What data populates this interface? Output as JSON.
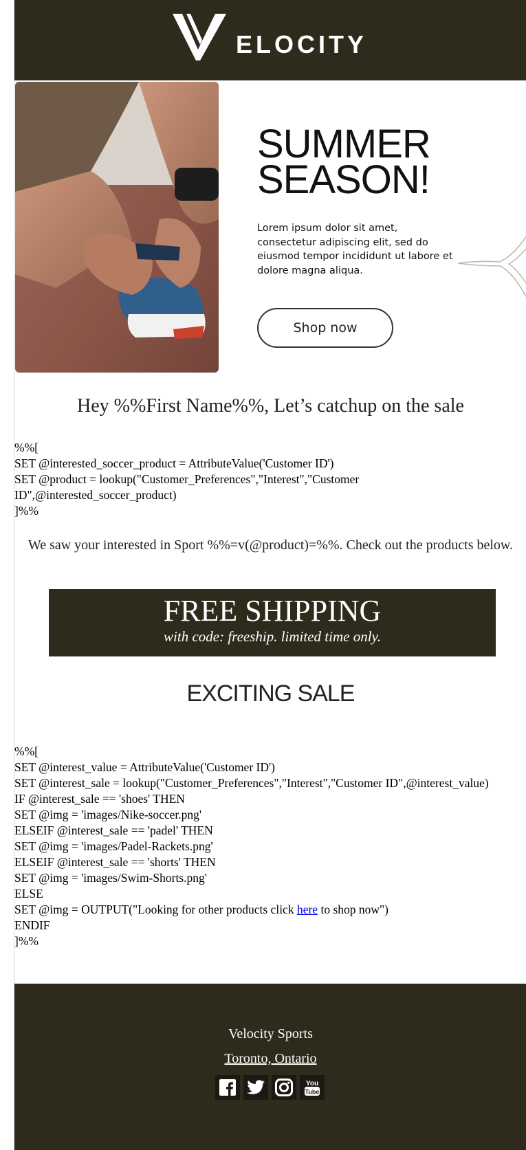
{
  "header": {
    "brand": "ELOCITY",
    "logo_icon": "velocity-v-logo-icon",
    "color": "#2e2a1c"
  },
  "hero": {
    "title_line1": "SUMMER",
    "title_line2": "SEASON!",
    "copy": "Lorem ipsum dolor sit amet, consectetur adipiscing elit, sed do eiusmod tempor incididunt ut labore et dolore magna aliqua.",
    "button": "Shop now",
    "image": "runner-tying-shoe-photo"
  },
  "greeting": "Hey %%First Name%%, Let’s catchup on the sale",
  "script1": "%%[\nSET @interested_soccer_product = AttributeValue('Customer ID')\nSET @product = lookup(\"Customer_Preferences\",\"Interest\",\"Customer ID\",@interested_soccer_product)\n]%%",
  "interest_text": "We saw your interested in Sport %%=v(@product)=%%. Check out the products below.",
  "banner": {
    "title": "FREE SHIPPING",
    "subtitle": "with code: freeship. limited time only."
  },
  "sale_title": "EXCITING SALE",
  "script2": {
    "before_link": "%%[\nSET @interest_value = AttributeValue('Customer ID')\nSET @interest_sale = lookup(\"Customer_Preferences\",\"Interest\",\"Customer ID\",@interest_value)\nIF @interest_sale == 'shoes' THEN\nSET @img = 'images/Nike-soccer.png'\nELSEIF @interest_sale == 'padel' THEN\nSET @img = 'images/Padel-Rackets.png'\nELSEIF @interest_sale == 'shorts' THEN\nSET @img = 'images/Swim-Shorts.png'\nELSE\nSET @img = OUTPUT(\"Looking for other products click ",
    "link": "here",
    "after_link": " to shop now\")\nENDIF\n]%%"
  },
  "footer": {
    "name": "Velocity Sports",
    "location": "Toronto, Ontario",
    "social": [
      "facebook-icon",
      "twitter-icon",
      "instagram-icon",
      "youtube-icon"
    ]
  }
}
